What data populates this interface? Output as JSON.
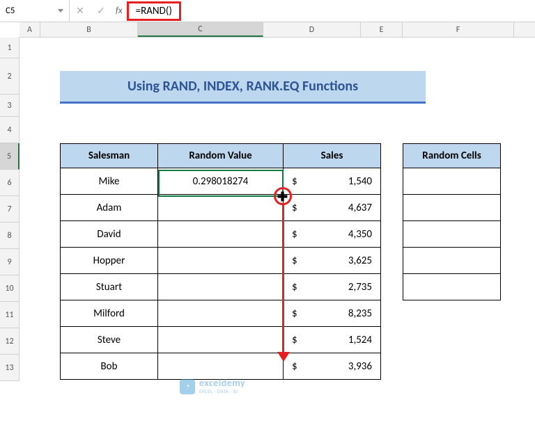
{
  "namebox": {
    "ref": "C5"
  },
  "formula": {
    "text": "=RAND()"
  },
  "columns": [
    "A",
    "B",
    "C",
    "D",
    "E",
    "F"
  ],
  "selected_col": "C",
  "rows": [
    "1",
    "2",
    "3",
    "4",
    "5",
    "6",
    "7",
    "8",
    "9",
    "10",
    "11",
    "12",
    "13"
  ],
  "selected_row": "5",
  "banner": {
    "title": "Using RAND, INDEX, RANK.EQ Functions"
  },
  "table": {
    "headers": {
      "b": "Salesman",
      "c": "Random Value",
      "d": "Sales"
    },
    "rows": [
      {
        "name": "Mike",
        "rand": "0.298018274",
        "cur": "$",
        "sales": "1,540"
      },
      {
        "name": "Adam",
        "rand": "",
        "cur": "$",
        "sales": "4,637"
      },
      {
        "name": "David",
        "rand": "",
        "cur": "$",
        "sales": "4,350"
      },
      {
        "name": "Hopper",
        "rand": "",
        "cur": "$",
        "sales": "3,625"
      },
      {
        "name": "Stuart",
        "rand": "",
        "cur": "$",
        "sales": "2,735"
      },
      {
        "name": "Milford",
        "rand": "",
        "cur": "$",
        "sales": "8,235"
      },
      {
        "name": "Steve",
        "rand": "",
        "cur": "$",
        "sales": "1,524"
      },
      {
        "name": "Bob",
        "rand": "",
        "cur": "$",
        "sales": "3,936"
      }
    ]
  },
  "rctable": {
    "header": "Random Cells"
  },
  "watermark": {
    "brand": "exceldemy",
    "tag": "EXCEL · DATA · BI"
  }
}
